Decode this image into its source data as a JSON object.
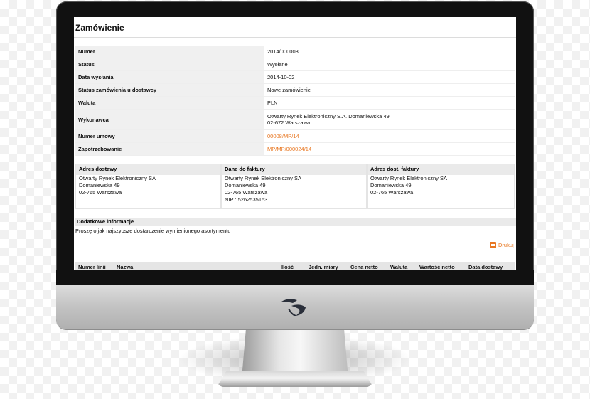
{
  "order": {
    "title": "Zamówienie",
    "rows": [
      {
        "label": "Numer",
        "value": "2014/000003"
      },
      {
        "label": "Status",
        "value": "Wysłane"
      },
      {
        "label": "Data wysłania",
        "value": "2014-10-02"
      },
      {
        "label": "Status zamówienia u dostawcy",
        "value": "Nowe zamówienie"
      },
      {
        "label": "Waluta",
        "value": "PLN"
      },
      {
        "label": "Wykonawca",
        "value": "Otwarty Rynek Elektroniczny S.A. Domaniewska 49",
        "value2": "02-672 Warszawa"
      },
      {
        "label": "Numer umowy",
        "value": "00008/MP/14"
      },
      {
        "label": "Zapotrzebowanie",
        "value": "MP/MP/000024/14"
      }
    ]
  },
  "addresses": [
    {
      "header": "Adres dostawy",
      "lines": [
        "Otwarty Rynek Elektroniczny SA",
        "Domaniewska 49",
        "02-765 Warszawa"
      ]
    },
    {
      "header": "Dane do faktury",
      "lines": [
        "Otwarty Rynek Elektroniczny SA",
        "Domaniewska 49",
        "02-765 Warszawa",
        "NIP : 5262535153"
      ]
    },
    {
      "header": "Adres dost. faktury",
      "lines": [
        "Otwarty Rynek Elektroniczny SA",
        "Domaniewska 49",
        "02-765 Warszawa"
      ]
    }
  ],
  "additional": {
    "header": "Dodatkowe informacje",
    "text": "Proszę o jak najszybsze dostarczenie wymienionego asortymentu"
  },
  "print_label": "Drukuj",
  "table": {
    "columns": [
      "Numer linii",
      "Nazwa",
      "Ilość",
      "Jedn. miary",
      "Cena netto",
      "Waluta",
      "Wartość netto",
      "Data dostawy"
    ]
  },
  "colors": {
    "link": "#e87722",
    "label_bg": "#f0f0f0"
  },
  "icons": {
    "print": "printer-icon",
    "logo": "brand-logo-icon"
  }
}
